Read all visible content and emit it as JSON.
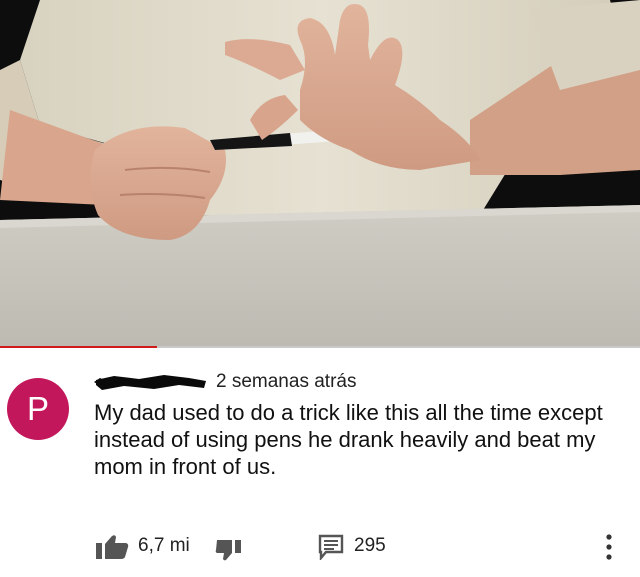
{
  "video": {
    "progress_fraction": 0.246,
    "progress_color": "#d11a1a"
  },
  "comment": {
    "avatar_letter": "P",
    "avatar_color": "#c2185b",
    "timestamp": "2 semanas atrás",
    "text": "My dad used to do a trick like this all the time except instead of using pens he drank heavily and beat my mom in front of us."
  },
  "actions": {
    "like_count": "6,7 mi",
    "reply_count": "295"
  },
  "icons": {
    "like": "thumbs-up-icon",
    "dislike": "thumbs-down-icon",
    "reply": "comment-icon",
    "more": "more-vertical-icon"
  }
}
